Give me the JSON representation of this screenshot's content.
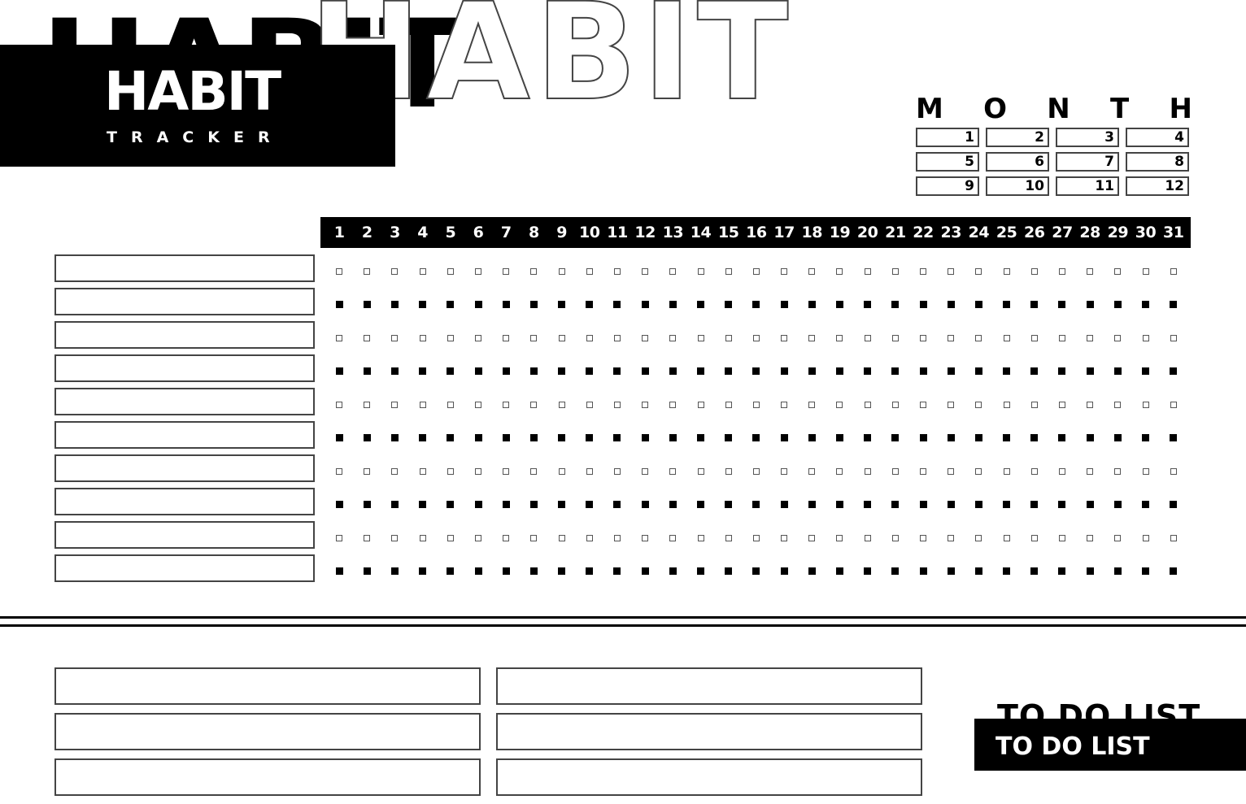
{
  "header": {
    "title_background_fill": "HABIT",
    "title_background_outline": "HABIT",
    "title": "HABIT",
    "subtitle": "TRACKER"
  },
  "month": {
    "label_letters": [
      "M",
      "O",
      "N",
      "T",
      "H"
    ],
    "options": [
      "1",
      "2",
      "3",
      "4",
      "5",
      "6",
      "7",
      "8",
      "9",
      "10",
      "11",
      "12"
    ]
  },
  "tracker": {
    "days": [
      "1",
      "2",
      "3",
      "4",
      "5",
      "6",
      "7",
      "8",
      "9",
      "10",
      "11",
      "12",
      "13",
      "14",
      "15",
      "16",
      "17",
      "18",
      "19",
      "20",
      "21",
      "22",
      "23",
      "24",
      "25",
      "26",
      "27",
      "28",
      "29",
      "30",
      "31"
    ],
    "habits": [
      {
        "name": "",
        "style": "hollow"
      },
      {
        "name": "",
        "style": "filled"
      },
      {
        "name": "",
        "style": "hollow"
      },
      {
        "name": "",
        "style": "filled"
      },
      {
        "name": "",
        "style": "hollow"
      },
      {
        "name": "",
        "style": "filled"
      },
      {
        "name": "",
        "style": "hollow"
      },
      {
        "name": "",
        "style": "filled"
      },
      {
        "name": "",
        "style": "hollow"
      },
      {
        "name": "",
        "style": "filled"
      }
    ]
  },
  "todo": {
    "title_background": "TO DO LIST",
    "title": "TO DO LIST",
    "columns": [
      [
        "",
        "",
        ""
      ],
      [
        "",
        "",
        ""
      ]
    ]
  }
}
